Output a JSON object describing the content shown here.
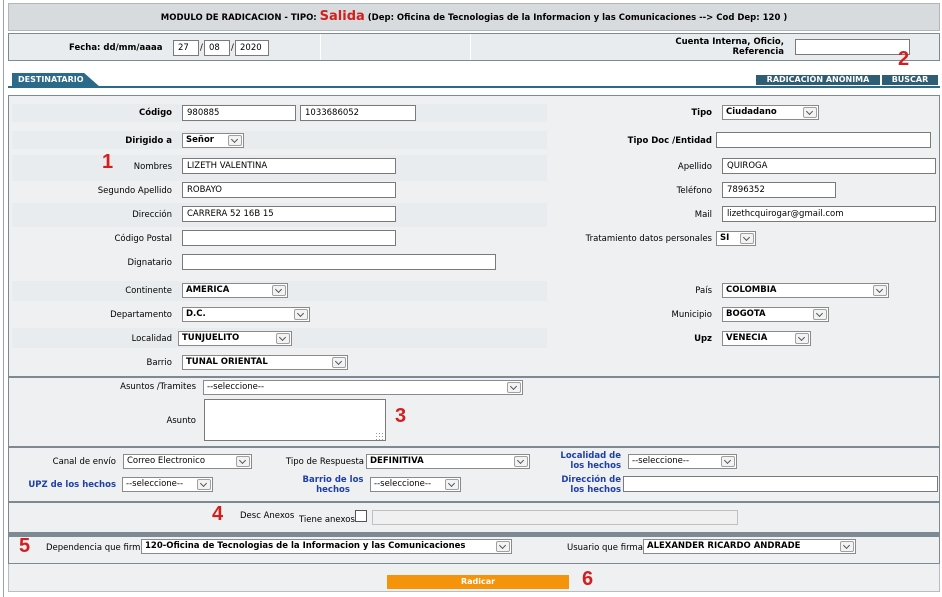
{
  "header": {
    "prefix": "MODULO DE RADICACION - TIPO:",
    "type": "Salida",
    "suffix": "(Dep: Oficina de Tecnologias de la Informacion y las Comunicaciones --> Cod Dep: 120 )"
  },
  "date": {
    "label": "Fecha: dd/mm/aaaa",
    "day": "27",
    "month": "08",
    "year": "2020"
  },
  "cuenta": {
    "label_1": "Cuenta Interna, Oficio,",
    "label_2": "Referencia",
    "value": ""
  },
  "tab": {
    "label": "DESTINATARIO"
  },
  "actions": {
    "anon": "RADICACIÓN ANÓNIMA",
    "search": "BUSCAR"
  },
  "markers": {
    "m1": "1",
    "m2": "2",
    "m3": "3",
    "m4": "4",
    "m5": "5",
    "m6": "6"
  },
  "dest": {
    "codigo_label": "Código",
    "codigo_1": "980885",
    "codigo_2": "1033686052",
    "tipo_label": "Tipo",
    "tipo_value": "Ciudadano",
    "dirigido_label": "Dirigido a",
    "dirigido_value": "Señor",
    "tipodoc_label": "Tipo Doc /Entidad",
    "tipodoc_value": "",
    "nombres_label": "Nombres",
    "nombres_value": "LIZETH VALENTINA",
    "apellido_label": "Apellido",
    "apellido_value": "QUIROGA",
    "segundo_label": "Segundo Apellido",
    "segundo_value": "ROBAYO",
    "telefono_label": "Teléfono",
    "telefono_value": "7896352",
    "direccion_label": "Dirección",
    "direccion_value": "CARRERA 52 16B 15",
    "mail_label": "Mail",
    "mail_value": "lizethcquirogar@gmail.com",
    "postal_label": "Código Postal",
    "postal_value": "",
    "tratamiento_label": "Tratamiento datos personales",
    "tratamiento_value": "SI",
    "dignatario_label": "Dignatario",
    "dignatario_value": "",
    "continente_label": "Continente",
    "continente_value": "AMERICA",
    "pais_label": "País",
    "pais_value": "COLOMBIA",
    "departamento_label": "Departamento",
    "departamento_value": "D.C.",
    "municipio_label": "Municipio",
    "municipio_value": "BOGOTA",
    "localidad_label": "Localidad",
    "localidad_value": "TUNJUELITO",
    "upz_label": "Upz",
    "upz_value": "VENECIA",
    "barrio_label": "Barrio",
    "barrio_value": "TUNAL ORIENTAL"
  },
  "asuntos": {
    "tramites_label": "Asuntos /Tramites",
    "tramites_value": "--seleccione--",
    "asunto_label": "Asunto",
    "asunto_value": ""
  },
  "envio": {
    "canal_label": "Canal de envío",
    "canal_value": "Correo Electronico",
    "respuesta_label": "Tipo de Respuesta",
    "respuesta_value": "DEFINITIVA",
    "localidad_label_1": "Localidad de",
    "localidad_label_2": "los hechos",
    "localidad_value": "--seleccione--",
    "upz_label": "UPZ de los hechos",
    "upz_value": "--seleccione--",
    "barrio_label_1": "Barrio de los",
    "barrio_label_2": "hechos",
    "barrio_value": "--seleccione--",
    "direccion_label_1": "Dirección de",
    "direccion_label_2": "los hechos",
    "direccion_value": ""
  },
  "anexos": {
    "desc_label": "Desc Anexos",
    "tiene_label": "Tiene anexos?",
    "desc_value": ""
  },
  "firma": {
    "dependencia_label": "Dependencia que firma",
    "dependencia_value": "120-Oficina de Tecnologias de la Informacion y las Comunicaciones",
    "usuario_label": "Usuario que firma",
    "usuario_value": "ALEXANDER RICARDO ANDRADE"
  },
  "submit": {
    "label": "Radicar"
  },
  "colors": {
    "accent": "#f5940b",
    "tab": "#2c6a8a",
    "red": "#d21e1e",
    "link": "#1f3fa6"
  }
}
